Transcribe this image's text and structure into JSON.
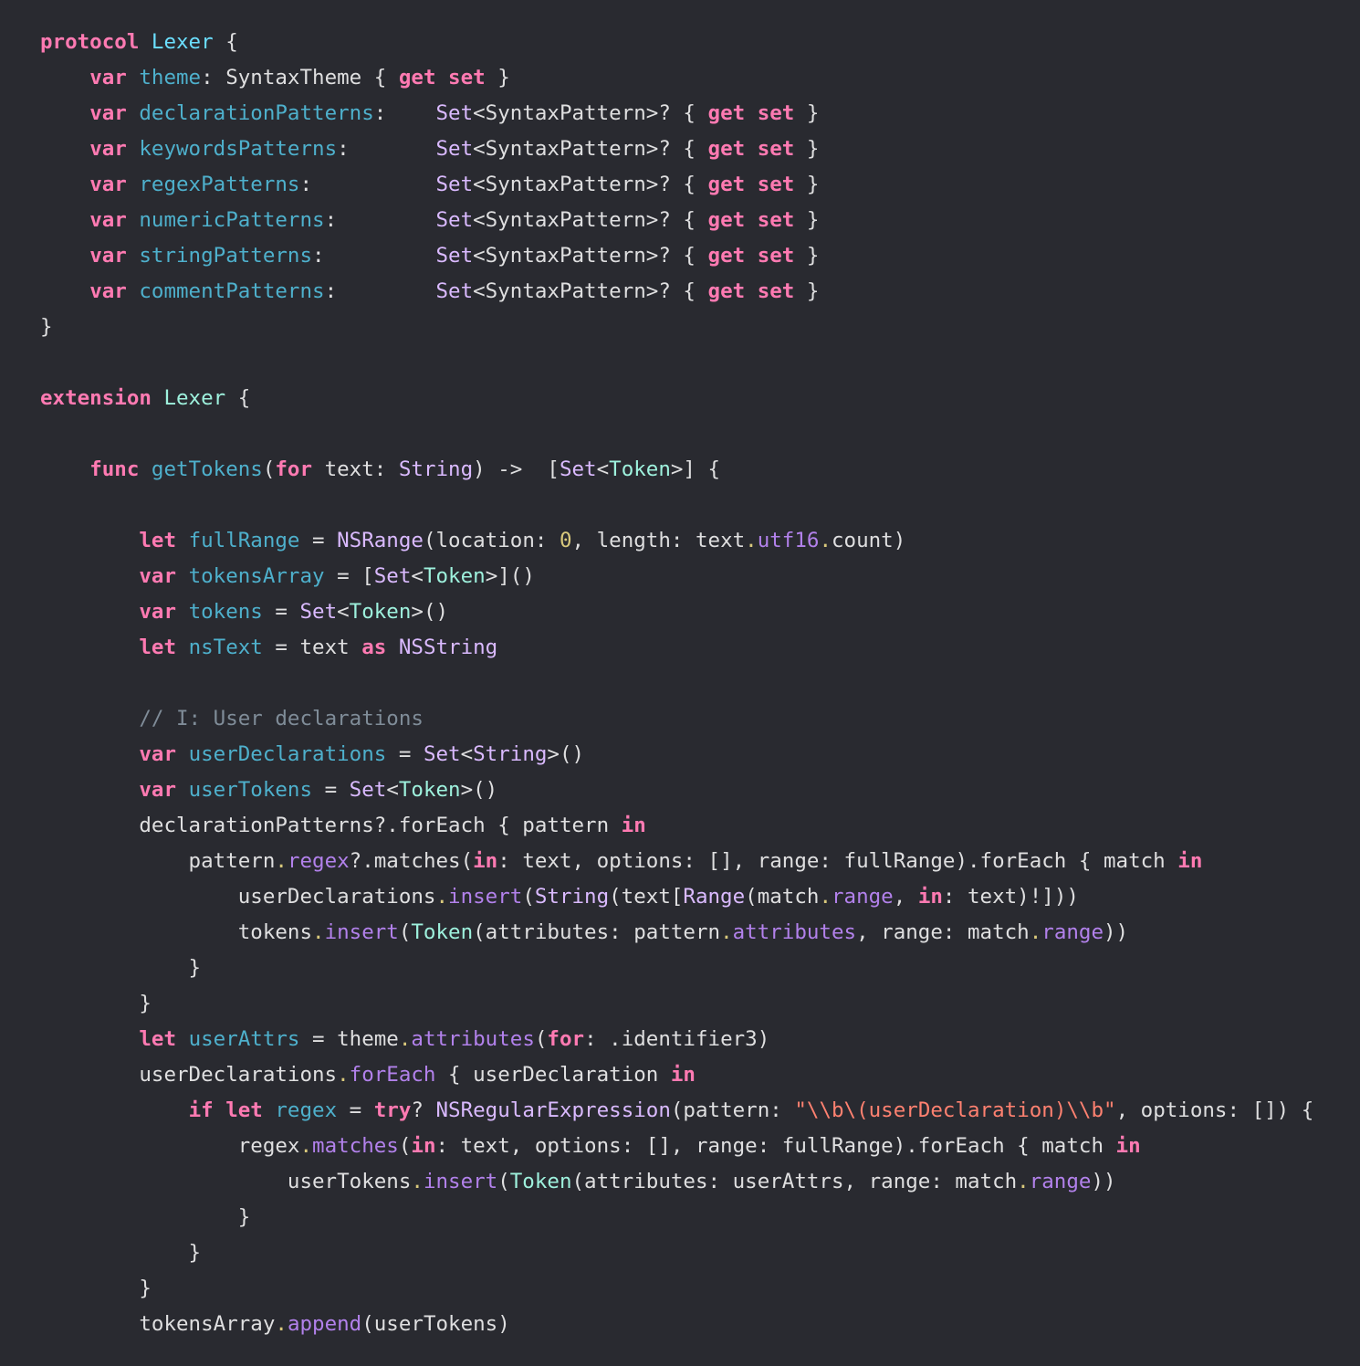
{
  "editor": {
    "language": "swift",
    "lines": [
      [
        [
          "protocol",
          "kw"
        ],
        [
          " ",
          "plain"
        ],
        [
          "Lexer",
          "decl-type"
        ],
        [
          " {",
          "plain"
        ]
      ],
      [
        [
          "    ",
          "plain"
        ],
        [
          "var",
          "kw"
        ],
        [
          " ",
          "plain"
        ],
        [
          "theme",
          "decl"
        ],
        [
          ": SyntaxTheme { ",
          "plain"
        ],
        [
          "get",
          "kw"
        ],
        [
          " ",
          "plain"
        ],
        [
          "set",
          "kw"
        ],
        [
          " }",
          "plain"
        ]
      ],
      [
        [
          "    ",
          "plain"
        ],
        [
          "var",
          "kw"
        ],
        [
          " ",
          "plain"
        ],
        [
          "declarationPatterns",
          "decl"
        ],
        [
          ":    ",
          "plain"
        ],
        [
          "Set",
          "stype"
        ],
        [
          "<SyntaxPattern>? { ",
          "plain"
        ],
        [
          "get",
          "kw"
        ],
        [
          " ",
          "plain"
        ],
        [
          "set",
          "kw"
        ],
        [
          " }",
          "plain"
        ]
      ],
      [
        [
          "    ",
          "plain"
        ],
        [
          "var",
          "kw"
        ],
        [
          " ",
          "plain"
        ],
        [
          "keywordsPatterns",
          "decl"
        ],
        [
          ":       ",
          "plain"
        ],
        [
          "Set",
          "stype"
        ],
        [
          "<SyntaxPattern>? { ",
          "plain"
        ],
        [
          "get",
          "kw"
        ],
        [
          " ",
          "plain"
        ],
        [
          "set",
          "kw"
        ],
        [
          " }",
          "plain"
        ]
      ],
      [
        [
          "    ",
          "plain"
        ],
        [
          "var",
          "kw"
        ],
        [
          " ",
          "plain"
        ],
        [
          "regexPatterns",
          "decl"
        ],
        [
          ":          ",
          "plain"
        ],
        [
          "Set",
          "stype"
        ],
        [
          "<SyntaxPattern>? { ",
          "plain"
        ],
        [
          "get",
          "kw"
        ],
        [
          " ",
          "plain"
        ],
        [
          "set",
          "kw"
        ],
        [
          " }",
          "plain"
        ]
      ],
      [
        [
          "    ",
          "plain"
        ],
        [
          "var",
          "kw"
        ],
        [
          " ",
          "plain"
        ],
        [
          "numericPatterns",
          "decl"
        ],
        [
          ":        ",
          "plain"
        ],
        [
          "Set",
          "stype"
        ],
        [
          "<SyntaxPattern>? { ",
          "plain"
        ],
        [
          "get",
          "kw"
        ],
        [
          " ",
          "plain"
        ],
        [
          "set",
          "kw"
        ],
        [
          " }",
          "plain"
        ]
      ],
      [
        [
          "    ",
          "plain"
        ],
        [
          "var",
          "kw"
        ],
        [
          " ",
          "plain"
        ],
        [
          "stringPatterns",
          "decl"
        ],
        [
          ":         ",
          "plain"
        ],
        [
          "Set",
          "stype"
        ],
        [
          "<SyntaxPattern>? { ",
          "plain"
        ],
        [
          "get",
          "kw"
        ],
        [
          " ",
          "plain"
        ],
        [
          "set",
          "kw"
        ],
        [
          " }",
          "plain"
        ]
      ],
      [
        [
          "    ",
          "plain"
        ],
        [
          "var",
          "kw"
        ],
        [
          " ",
          "plain"
        ],
        [
          "commentPatterns",
          "decl"
        ],
        [
          ":        ",
          "plain"
        ],
        [
          "Set",
          "stype"
        ],
        [
          "<SyntaxPattern>? { ",
          "plain"
        ],
        [
          "get",
          "kw"
        ],
        [
          " ",
          "plain"
        ],
        [
          "set",
          "kw"
        ],
        [
          " }",
          "plain"
        ]
      ],
      [
        [
          "}",
          "plain"
        ]
      ],
      [],
      [
        [
          "extension",
          "kw"
        ],
        [
          " ",
          "plain"
        ],
        [
          "Lexer",
          "ptype"
        ],
        [
          " {",
          "plain"
        ]
      ],
      [],
      [
        [
          "    ",
          "plain"
        ],
        [
          "func",
          "kw"
        ],
        [
          " ",
          "plain"
        ],
        [
          "getTokens",
          "decl"
        ],
        [
          "(",
          "plain"
        ],
        [
          "for",
          "kw"
        ],
        [
          " text: ",
          "plain"
        ],
        [
          "String",
          "stype"
        ],
        [
          ") ->  [",
          "plain"
        ],
        [
          "Set",
          "stype"
        ],
        [
          "<",
          "plain"
        ],
        [
          "Token",
          "ptype"
        ],
        [
          ">] {",
          "plain"
        ]
      ],
      [],
      [
        [
          "        ",
          "plain"
        ],
        [
          "let",
          "kw"
        ],
        [
          " ",
          "plain"
        ],
        [
          "fullRange",
          "decl"
        ],
        [
          " = ",
          "plain"
        ],
        [
          "NSRange",
          "stype"
        ],
        [
          "(location: ",
          "plain"
        ],
        [
          "0",
          "num"
        ],
        [
          ", length: text",
          "plain"
        ],
        [
          ".",
          "dot"
        ],
        [
          "utf16",
          "sprop"
        ],
        [
          ".",
          "dot"
        ],
        [
          "count)",
          "plain"
        ]
      ],
      [
        [
          "        ",
          "plain"
        ],
        [
          "var",
          "kw"
        ],
        [
          " ",
          "plain"
        ],
        [
          "tokensArray",
          "decl"
        ],
        [
          " = [",
          "plain"
        ],
        [
          "Set",
          "stype"
        ],
        [
          "<",
          "plain"
        ],
        [
          "Token",
          "ptype"
        ],
        [
          ">]()",
          "plain"
        ]
      ],
      [
        [
          "        ",
          "plain"
        ],
        [
          "var",
          "kw"
        ],
        [
          " ",
          "plain"
        ],
        [
          "tokens",
          "decl"
        ],
        [
          " = ",
          "plain"
        ],
        [
          "Set",
          "stype"
        ],
        [
          "<",
          "plain"
        ],
        [
          "Token",
          "ptype"
        ],
        [
          ">()",
          "plain"
        ]
      ],
      [
        [
          "        ",
          "plain"
        ],
        [
          "let",
          "kw"
        ],
        [
          " ",
          "plain"
        ],
        [
          "nsText",
          "decl"
        ],
        [
          " = text ",
          "plain"
        ],
        [
          "as",
          "kw"
        ],
        [
          " ",
          "plain"
        ],
        [
          "NSString",
          "stype"
        ]
      ],
      [],
      [
        [
          "        ",
          "plain"
        ],
        [
          "// I: User declarations",
          "cmt"
        ]
      ],
      [
        [
          "        ",
          "plain"
        ],
        [
          "var",
          "kw"
        ],
        [
          " ",
          "plain"
        ],
        [
          "userDeclarations",
          "decl"
        ],
        [
          " = ",
          "plain"
        ],
        [
          "Set",
          "stype"
        ],
        [
          "<",
          "plain"
        ],
        [
          "String",
          "stype"
        ],
        [
          ">()",
          "plain"
        ]
      ],
      [
        [
          "        ",
          "plain"
        ],
        [
          "var",
          "kw"
        ],
        [
          " ",
          "plain"
        ],
        [
          "userTokens",
          "decl"
        ],
        [
          " = ",
          "plain"
        ],
        [
          "Set",
          "stype"
        ],
        [
          "<",
          "plain"
        ],
        [
          "Token",
          "ptype"
        ],
        [
          ">()",
          "plain"
        ]
      ],
      [
        [
          "        declarationPatterns?.forEach { pattern ",
          "plain"
        ],
        [
          "in",
          "kw"
        ]
      ],
      [
        [
          "            pattern",
          "plain"
        ],
        [
          ".",
          "dot"
        ],
        [
          "regex",
          "sprop"
        ],
        [
          "?.matches(",
          "plain"
        ],
        [
          "in",
          "kw"
        ],
        [
          ": text, options: [], range: fullRange).forEach { match ",
          "plain"
        ],
        [
          "in",
          "kw"
        ]
      ],
      [
        [
          "                userDeclarations",
          "plain"
        ],
        [
          ".",
          "dot"
        ],
        [
          "insert",
          "sprop"
        ],
        [
          "(",
          "plain"
        ],
        [
          "String",
          "stype"
        ],
        [
          "(text[",
          "plain"
        ],
        [
          "Range",
          "stype"
        ],
        [
          "(match",
          "plain"
        ],
        [
          ".",
          "dot"
        ],
        [
          "range",
          "sprop"
        ],
        [
          ", ",
          "plain"
        ],
        [
          "in",
          "kw"
        ],
        [
          ": text)!]))",
          "plain"
        ]
      ],
      [
        [
          "                tokens",
          "plain"
        ],
        [
          ".",
          "dot"
        ],
        [
          "insert",
          "sprop"
        ],
        [
          "(",
          "plain"
        ],
        [
          "Token",
          "ptype"
        ],
        [
          "(attributes: pattern",
          "plain"
        ],
        [
          ".",
          "dot"
        ],
        [
          "attributes",
          "sprop"
        ],
        [
          ", range: match",
          "plain"
        ],
        [
          ".",
          "dot"
        ],
        [
          "range",
          "sprop"
        ],
        [
          "))",
          "plain"
        ]
      ],
      [
        [
          "            }",
          "plain"
        ]
      ],
      [
        [
          "        }",
          "plain"
        ]
      ],
      [
        [
          "        ",
          "plain"
        ],
        [
          "let",
          "kw"
        ],
        [
          " ",
          "plain"
        ],
        [
          "userAttrs",
          "decl"
        ],
        [
          " = theme",
          "plain"
        ],
        [
          ".",
          "dot"
        ],
        [
          "attributes",
          "sprop"
        ],
        [
          "(",
          "plain"
        ],
        [
          "for",
          "kw"
        ],
        [
          ": .identifier3)",
          "plain"
        ]
      ],
      [
        [
          "        userDeclarations",
          "plain"
        ],
        [
          ".",
          "dot"
        ],
        [
          "forEach",
          "sprop"
        ],
        [
          " { userDeclaration ",
          "plain"
        ],
        [
          "in",
          "kw"
        ]
      ],
      [
        [
          "            ",
          "plain"
        ],
        [
          "if",
          "kw"
        ],
        [
          " ",
          "plain"
        ],
        [
          "let",
          "kw"
        ],
        [
          " ",
          "plain"
        ],
        [
          "regex",
          "decl"
        ],
        [
          " = ",
          "plain"
        ],
        [
          "try",
          "kw"
        ],
        [
          "? ",
          "plain"
        ],
        [
          "NSRegularExpression",
          "stype"
        ],
        [
          "(pattern: ",
          "plain"
        ],
        [
          "\"\\\\b\\(userDeclaration)\\\\b\"",
          "str"
        ],
        [
          ", options: []) {",
          "plain"
        ]
      ],
      [
        [
          "                regex",
          "plain"
        ],
        [
          ".",
          "dot"
        ],
        [
          "matches",
          "sprop"
        ],
        [
          "(",
          "plain"
        ],
        [
          "in",
          "kw"
        ],
        [
          ": text, options: [], range: fullRange).forEach { match ",
          "plain"
        ],
        [
          "in",
          "kw"
        ]
      ],
      [
        [
          "                    userTokens",
          "plain"
        ],
        [
          ".",
          "dot"
        ],
        [
          "insert",
          "sprop"
        ],
        [
          "(",
          "plain"
        ],
        [
          "Token",
          "ptype"
        ],
        [
          "(attributes: userAttrs, range: match",
          "plain"
        ],
        [
          ".",
          "dot"
        ],
        [
          "range",
          "sprop"
        ],
        [
          "))",
          "plain"
        ]
      ],
      [
        [
          "                }",
          "plain"
        ]
      ],
      [
        [
          "            }",
          "plain"
        ]
      ],
      [
        [
          "        }",
          "plain"
        ]
      ],
      [
        [
          "        tokensArray",
          "plain"
        ],
        [
          ".",
          "dot"
        ],
        [
          "append",
          "sprop"
        ],
        [
          "(userTokens)",
          "plain"
        ]
      ]
    ]
  }
}
